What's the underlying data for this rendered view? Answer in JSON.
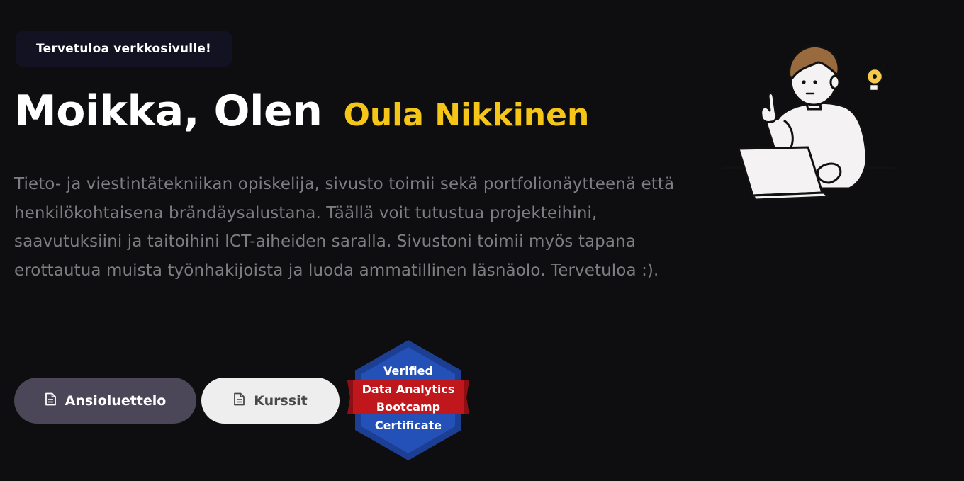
{
  "hero": {
    "welcome": "Tervetuloa verkkosivulle!",
    "greeting": "Moikka, Olen",
    "name": "Oula Nikkinen",
    "intro": "Tieto- ja viestintätekniikan opiskelija, sivusto toimii sekä portfolionäytteenä että henkilökohtaisena brändäysalustana. Täällä voit tutustua projekteihini, saavutuksiini ja taitoihini ICT-aiheiden saralla. Sivustoni toimii myös tapana erottautua muista työnhakijoista ja luoda ammatillinen läsnäolo. Tervetuloa :)."
  },
  "buttons": {
    "cv_label": "Ansioluettelo",
    "cv_icon": "document-icon",
    "courses_label": "Kurssit",
    "courses_icon": "document-icon"
  },
  "badge": {
    "line1": "Verified",
    "line2": "Data Analytics",
    "line3": "Bootcamp",
    "line4": "Certificate"
  },
  "illustration": {
    "subject": "person-with-laptop-and-lightbulb"
  },
  "colors": {
    "background": "#0e0e10",
    "accent": "#f5c518",
    "body_text": "#7d7d82",
    "primary_button": "#4b4658",
    "secondary_button": "#eeeeee",
    "badge_blue": "#2451b8",
    "badge_red": "#c0171c"
  }
}
